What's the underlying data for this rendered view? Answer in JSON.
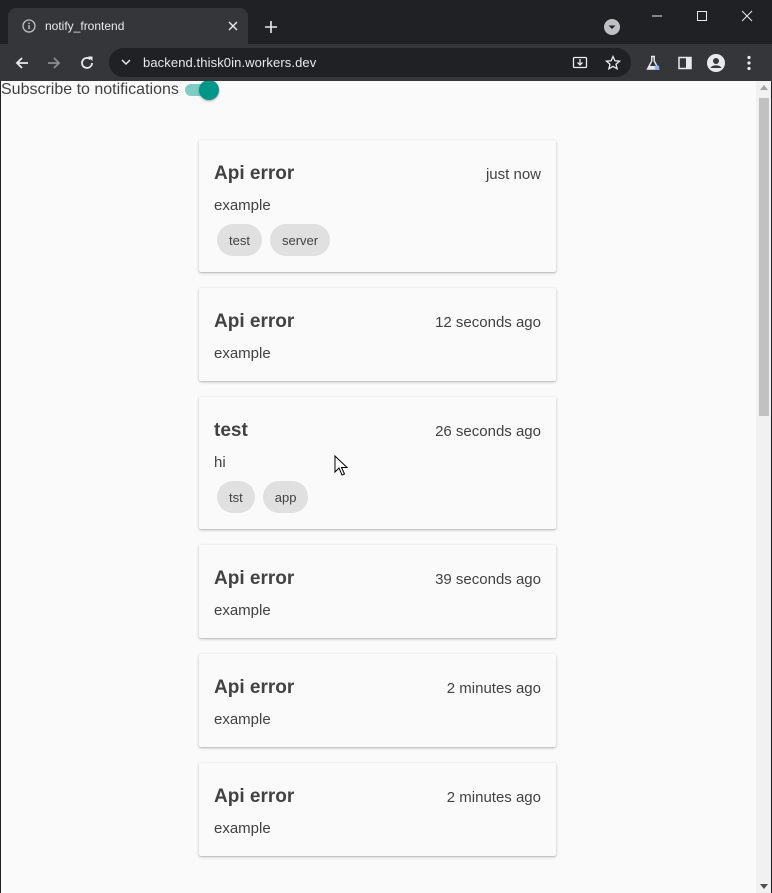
{
  "browser": {
    "tab": {
      "title": "notify_frontend",
      "favicon": "info-icon"
    },
    "omnibox": {
      "url": "backend.thisk0in.workers.dev"
    },
    "icons": {
      "back": "arrow-left-icon",
      "forward": "arrow-right-icon",
      "reload": "reload-icon",
      "install": "install-app-icon",
      "bookmark": "star-icon",
      "labs": "flask-icon",
      "sidepanel": "side-panel-icon",
      "profile": "profile-icon",
      "menu": "kebab-menu-icon"
    }
  },
  "page": {
    "subscribe": {
      "label": "Subscribe to notifications",
      "enabled": true
    },
    "notifications": [
      {
        "title": "Api error",
        "time": "just now",
        "body": "example",
        "tags": [
          "test",
          "server"
        ]
      },
      {
        "title": "Api error",
        "time": "12 seconds ago",
        "body": "example",
        "tags": []
      },
      {
        "title": "test",
        "time": "26 seconds ago",
        "body": "hi",
        "tags": [
          "tst",
          "app"
        ]
      },
      {
        "title": "Api error",
        "time": "39 seconds ago",
        "body": "example",
        "tags": []
      },
      {
        "title": "Api error",
        "time": "2 minutes ago",
        "body": "example",
        "tags": []
      },
      {
        "title": "Api error",
        "time": "2 minutes ago",
        "body": "example",
        "tags": []
      }
    ]
  },
  "colors": {
    "accent": "#009688",
    "accent_track": "#80cbc4",
    "text": "#424242",
    "chip": "#e0e0e0",
    "chrome_dark": "#202124",
    "chrome_toolbar": "#35363a"
  }
}
